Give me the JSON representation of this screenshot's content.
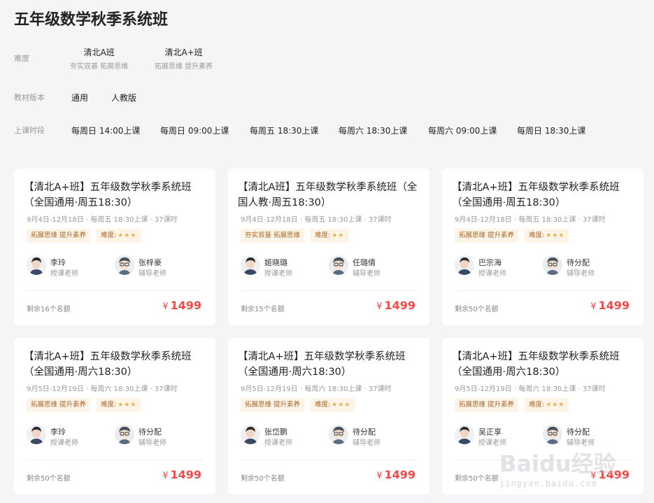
{
  "page_title": "五年级数学秋季系统班",
  "filters": {
    "difficulty": {
      "label": "难度",
      "options": [
        {
          "name": "清北A班",
          "sub": "夯实双基 拓展思维"
        },
        {
          "name": "清北A+班",
          "sub": "拓展思维 提升素养"
        }
      ]
    },
    "edition": {
      "label": "教材版本",
      "options": [
        "通用",
        "人教版"
      ]
    },
    "schedule": {
      "label": "上课时段",
      "options": [
        "每周日 14:00上课",
        "每周日 09:00上课",
        "每周五 18:30上课",
        "每周六 18:30上课",
        "每周六 09:00上课",
        "每周日 18:30上课"
      ]
    }
  },
  "cards": [
    {
      "title": "【清北A+班】五年级数学秋季系统班（全国通用·周五18:30）",
      "meta": "9月4日-12月18日 · 每周五 18:30上课 · 37课时",
      "tag": "拓展思维 提升素养",
      "difficulty_label": "难度:",
      "stars": "★★★",
      "teacher": "李玲",
      "teacher_role": "授课老师",
      "tutor": "张梓豪",
      "tutor_role": "辅导老师",
      "remaining": "剩余16个名额",
      "currency": "¥",
      "price": "1499"
    },
    {
      "title": "【清北A班】五年级数学秋季系统班（全国人教·周五18:30）",
      "meta": "9月4日-12月18日 · 每周五 18:30上课 · 37课时",
      "tag": "夯实双基 拓展思维",
      "difficulty_label": "难度:",
      "stars": "★★",
      "teacher": "姬晓璐",
      "teacher_role": "授课老师",
      "tutor": "任璐倩",
      "tutor_role": "辅导老师",
      "remaining": "剩余15个名额",
      "currency": "¥",
      "price": "1499"
    },
    {
      "title": "【清北A+班】五年级数学秋季系统班（全国通用·周五18:30）",
      "meta": "9月4日-12月18日 · 每周五 18:30上课 · 37课时",
      "tag": "拓展思维 提升素养",
      "difficulty_label": "难度:",
      "stars": "★★★",
      "teacher": "巴宗海",
      "teacher_role": "授课老师",
      "tutor": "待分配",
      "tutor_role": "辅导老师",
      "remaining": "剩余50个名额",
      "currency": "¥",
      "price": "1499"
    },
    {
      "title": "【清北A+班】五年级数学秋季系统班（全国通用·周六18:30）",
      "meta": "9月5日-12月19日 · 每周六 18:30上课 · 37课时",
      "tag": "拓展思维 提升素养",
      "difficulty_label": "难度:",
      "stars": "★★★",
      "teacher": "李玲",
      "teacher_role": "授课老师",
      "tutor": "待分配",
      "tutor_role": "辅导老师",
      "remaining": "剩余50个名额",
      "currency": "¥",
      "price": "1499"
    },
    {
      "title": "【清北A+班】五年级数学秋季系统班（全国通用·周六18:30）",
      "meta": "9月5日-12月19日 · 每周六 18:30上课 · 37课时",
      "tag": "拓展思维 提升素养",
      "difficulty_label": "难度:",
      "stars": "★★★",
      "teacher": "张岱鹏",
      "teacher_role": "授课老师",
      "tutor": "待分配",
      "tutor_role": "辅导老师",
      "remaining": "剩余50个名额",
      "currency": "¥",
      "price": "1499"
    },
    {
      "title": "【清北A+班】五年级数学秋季系统班（全国通用·周六18:30）",
      "meta": "9月5日-12月19日 · 每周六 18:30上课 · 37课时",
      "tag": "拓展思维 提升素养",
      "difficulty_label": "难度:",
      "stars": "★★★",
      "teacher": "吴正享",
      "teacher_role": "授课老师",
      "tutor": "待分配",
      "tutor_role": "辅导老师",
      "remaining": "剩余50个名额",
      "currency": "¥",
      "price": "1499"
    }
  ],
  "watermark": {
    "logo": "Baidu经验",
    "url": "jingyan.baidu.com"
  },
  "colors": {
    "price": "#f04a4a",
    "tag_bg": "#fdf4e8",
    "tag_text": "#a8662b",
    "star": "#e8b34c"
  }
}
